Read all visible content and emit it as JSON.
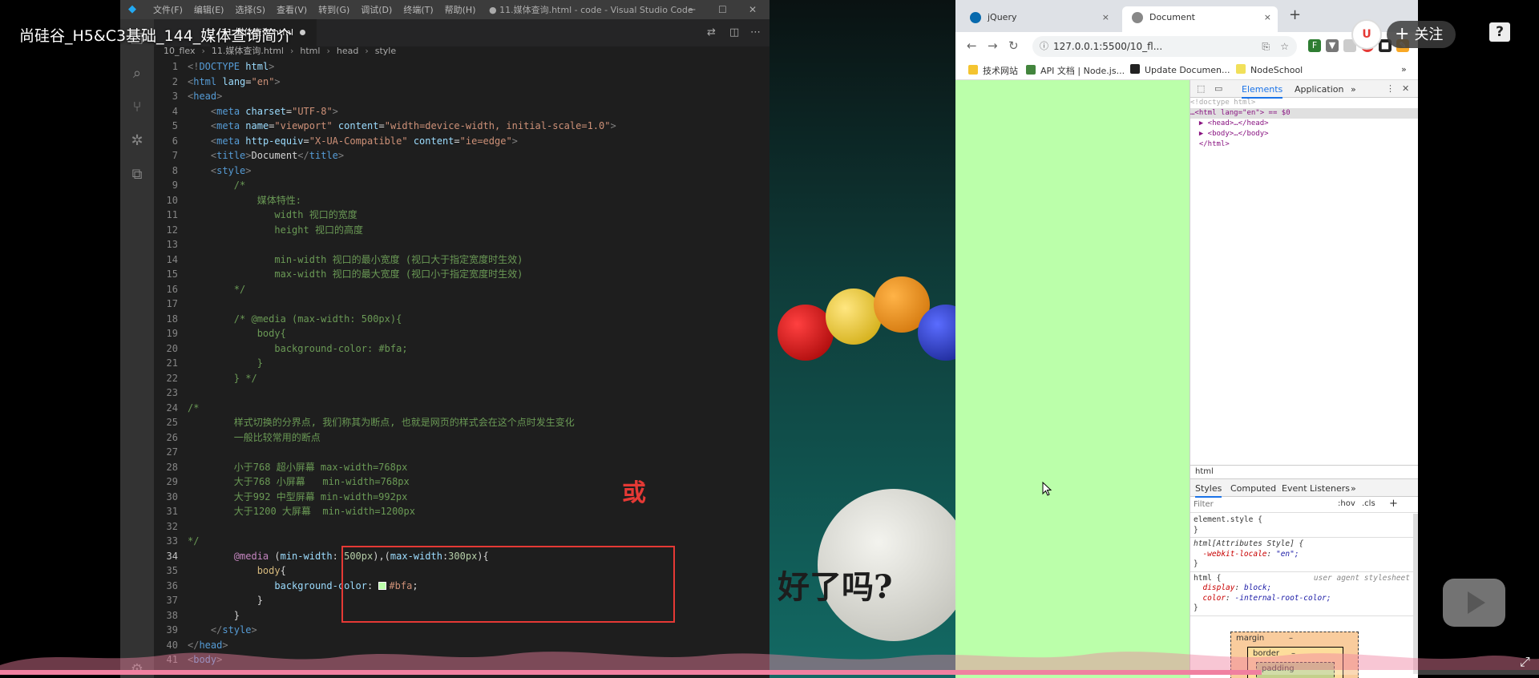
{
  "video": {
    "title": "尚硅谷_H5&C3基础_144_媒体查询简介",
    "follow_label": "关注",
    "help_label": "?",
    "uploader_logo_text": "U",
    "progress": 0.82
  },
  "vscode": {
    "menus": [
      "文件(F)",
      "编辑(E)",
      "选择(S)",
      "查看(V)",
      "转到(G)",
      "调试(D)",
      "终端(T)",
      "帮助(H)"
    ],
    "window_title": "● 11.媒体查询.html - code - Visual Studio Code",
    "tab_label": "11.媒体查询.html",
    "breadcrumb": [
      "10_flex",
      "11.媒体查询.html",
      "html",
      "head",
      "style"
    ],
    "current_line": 34,
    "annotation": "或",
    "swatch_color": "#bbffaa",
    "lines": [
      {
        "n": 1,
        "html": "<span class=\"tk-br\">&lt;!</span><span class=\"tk-tag\">DOCTYPE</span> <span class=\"tk-attr\">html</span><span class=\"tk-br\">&gt;</span>"
      },
      {
        "n": 2,
        "html": "<span class=\"tk-br\">&lt;</span><span class=\"tk-tag\">html</span> <span class=\"tk-attr\">lang</span>=<span class=\"tk-str\">\"en\"</span><span class=\"tk-br\">&gt;</span>"
      },
      {
        "n": 3,
        "html": "<span class=\"tk-br\">&lt;</span><span class=\"tk-tag\">head</span><span class=\"tk-br\">&gt;</span>"
      },
      {
        "n": 4,
        "html": "    <span class=\"tk-br\">&lt;</span><span class=\"tk-tag\">meta</span> <span class=\"tk-attr\">charset</span>=<span class=\"tk-str\">\"UTF-8\"</span><span class=\"tk-br\">&gt;</span>"
      },
      {
        "n": 5,
        "html": "    <span class=\"tk-br\">&lt;</span><span class=\"tk-tag\">meta</span> <span class=\"tk-attr\">name</span>=<span class=\"tk-str\">\"viewport\"</span> <span class=\"tk-attr\">content</span>=<span class=\"tk-str\">\"width=device-width, initial-scale=1.0\"</span><span class=\"tk-br\">&gt;</span>"
      },
      {
        "n": 6,
        "html": "    <span class=\"tk-br\">&lt;</span><span class=\"tk-tag\">meta</span> <span class=\"tk-attr\">http-equiv</span>=<span class=\"tk-str\">\"X-UA-Compatible\"</span> <span class=\"tk-attr\">content</span>=<span class=\"tk-str\">\"ie=edge\"</span><span class=\"tk-br\">&gt;</span>"
      },
      {
        "n": 7,
        "html": "    <span class=\"tk-br\">&lt;</span><span class=\"tk-tag\">title</span><span class=\"tk-br\">&gt;</span><span class=\"tk-txt\">Document</span><span class=\"tk-br\">&lt;/</span><span class=\"tk-tag\">title</span><span class=\"tk-br\">&gt;</span>"
      },
      {
        "n": 8,
        "html": "    <span class=\"tk-br\">&lt;</span><span class=\"tk-tag\">style</span><span class=\"tk-br\">&gt;</span>"
      },
      {
        "n": 9,
        "html": "        <span class=\"tk-com\">/*</span>"
      },
      {
        "n": 10,
        "html": "            <span class=\"tk-com\">媒体特性:</span>"
      },
      {
        "n": 11,
        "html": "               <span class=\"tk-com\">width 视口的宽度</span>"
      },
      {
        "n": 12,
        "html": "               <span class=\"tk-com\">height 视口的高度</span>"
      },
      {
        "n": 13,
        "html": ""
      },
      {
        "n": 14,
        "html": "               <span class=\"tk-com\">min-width 视口的最小宽度 (视口大于指定宽度时生效)</span>"
      },
      {
        "n": 15,
        "html": "               <span class=\"tk-com\">max-width 视口的最大宽度 (视口小于指定宽度时生效)</span>"
      },
      {
        "n": 16,
        "html": "        <span class=\"tk-com\">*/</span>"
      },
      {
        "n": 17,
        "html": ""
      },
      {
        "n": 18,
        "html": "        <span class=\"tk-com\">/* @media (max-width: 500px){</span>"
      },
      {
        "n": 19,
        "html": "            <span class=\"tk-com\">body{</span>"
      },
      {
        "n": 20,
        "html": "               <span class=\"tk-com\">background-color: #bfa;</span>"
      },
      {
        "n": 21,
        "html": "            <span class=\"tk-com\">}</span>"
      },
      {
        "n": 22,
        "html": "        <span class=\"tk-com\">} */</span>"
      },
      {
        "n": 23,
        "html": ""
      },
      {
        "n": 24,
        "html": "<span class=\"tk-com\">/*</span>"
      },
      {
        "n": 25,
        "html": "        <span class=\"tk-com\">样式切换的分界点, 我们称其为断点, 也就是网页的样式会在这个点时发生变化</span>"
      },
      {
        "n": 26,
        "html": "        <span class=\"tk-com\">一般比较常用的断点</span>"
      },
      {
        "n": 27,
        "html": ""
      },
      {
        "n": 28,
        "html": "        <span class=\"tk-com\">小于768 超小屏幕 max-width=768px</span>"
      },
      {
        "n": 29,
        "html": "        <span class=\"tk-com\">大于768 小屏幕   min-width=768px</span>"
      },
      {
        "n": 30,
        "html": "        <span class=\"tk-com\">大于992 中型屏幕 min-width=992px</span>"
      },
      {
        "n": 31,
        "html": "        <span class=\"tk-com\">大于1200 大屏幕  min-width=1200px</span>"
      },
      {
        "n": 32,
        "html": ""
      },
      {
        "n": 33,
        "html": "<span class=\"tk-com\">*/</span>"
      },
      {
        "n": 34,
        "html": "        <span class=\"tk-kw\">@media</span> (<span class=\"tk-prop\">min-width</span>: <span class=\"tk-num\">500px</span>),(<span class=\"tk-prop\">max-width</span>:<span class=\"tk-num\">300px</span>){"
      },
      {
        "n": 35,
        "html": "            <span class=\"tk-sel\">body</span>{"
      },
      {
        "n": 36,
        "html": "               <span class=\"tk-prop\">background-color</span>: <span class=\"swatch\"></span><span class=\"tk-str\">#bfa</span>;"
      },
      {
        "n": 37,
        "html": "            }"
      },
      {
        "n": 38,
        "html": "        }"
      },
      {
        "n": 39,
        "html": "    <span class=\"tk-br\">&lt;/</span><span class=\"tk-tag\">style</span><span class=\"tk-br\">&gt;</span>"
      },
      {
        "n": 40,
        "html": "<span class=\"tk-br\">&lt;/</span><span class=\"tk-tag\">head</span><span class=\"tk-br\">&gt;</span>"
      },
      {
        "n": 41,
        "html": "<span class=\"tk-br\">&lt;</span><span class=\"tk-tag\">body</span><span class=\"tk-br\">&gt;</span>"
      }
    ]
  },
  "background": {
    "caption": "好了吗?"
  },
  "browser": {
    "tabs": [
      {
        "label": "jQuery",
        "close": "×"
      },
      {
        "label": "Document",
        "close": "×"
      }
    ],
    "new_tab": "+",
    "url": "127.0.0.1:5500/10_fl...",
    "bookmarks": [
      "技术网站",
      "API 文档 | Node.js...",
      "Update Documen...",
      "NodeSchool"
    ],
    "bookmarks_more": "»",
    "page_bg": "#bbffaa",
    "devtools": {
      "tabs": [
        "Elements",
        "Application"
      ],
      "tabs_more": "»",
      "tree": [
        {
          "text": "<!doctype html>"
        },
        {
          "text": "…<html lang=\"en\"> == $0"
        },
        {
          "text": "  ▶ <head>…</head>"
        },
        {
          "text": "  ▶ <body>…</body>"
        },
        {
          "text": "  </html>"
        }
      ],
      "crumb": "html",
      "style_tabs": [
        "Styles",
        "Computed",
        "Event Listeners"
      ],
      "filter_placeholder": "Filter",
      "filter_hov": ":hov",
      "filter_cls": ".cls",
      "filter_add": "+",
      "rules": [
        {
          "selector": "element.style {",
          "decls": [],
          "close": "}"
        },
        {
          "selector": "html[Attributes Style] {",
          "decls": [
            {
              "prop": "-webkit-locale",
              "val": "\"en\";"
            }
          ],
          "close": "}"
        },
        {
          "selector": "html {",
          "source": "user agent stylesheet",
          "decls": [
            {
              "prop": "display",
              "val": "block;"
            },
            {
              "prop": "color",
              "val": "-internal-root-color;"
            }
          ],
          "close": "}"
        }
      ],
      "boxmodel": {
        "margin": "margin",
        "border": "border",
        "padding": "padding",
        "dash": "–"
      }
    }
  }
}
